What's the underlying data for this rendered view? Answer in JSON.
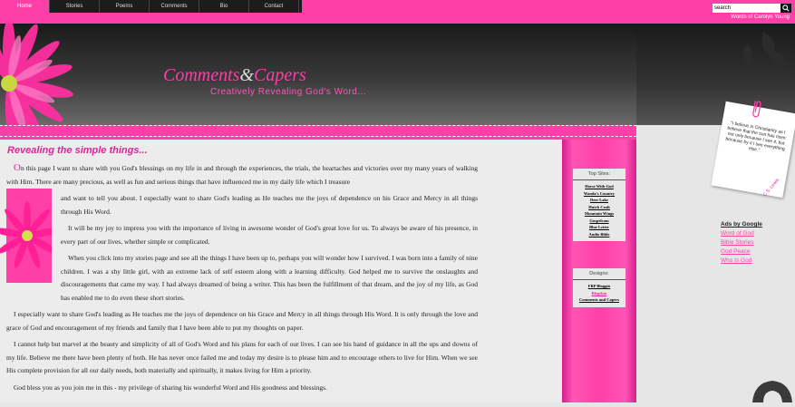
{
  "nav": {
    "items": [
      "Home",
      "Stories",
      "Poems",
      "Comments",
      "Bio",
      "Contact"
    ],
    "active": "Home"
  },
  "search": {
    "value": "search"
  },
  "header": {
    "tagline": "Words of Carolyn Young",
    "title_left": "Comments",
    "title_amp": "&",
    "title_right": "Capers",
    "subtitle": "Creatively Revealing God's Word..."
  },
  "content": {
    "heading": "Revealing the simple things...",
    "dropcap": "O",
    "p1a": "n this page I want to share with you God's blessings on my life in and through the experiences, the trials, the heartaches and victories over my many years of walking with Him. There are many precious, as well as fun and serious things that have influenced me in my daily life which I treasure",
    "p1b": "and want to tell you about. I especially want to share God's leading as He teaches me the joys of dependence on his Grace and Mercy in all things through His Word.",
    "p2": "It will be my joy to impress you with the importance of living in awesome wonder of God's great love for us. To always be aware of his presence, in every part of our lives, whether simple or complicated.",
    "p3": "When you click into my stories page and see all the things I have been up to, perhaps you will wonder how I survived. I was born into a family of nine children. I was a shy little girl, with an extreme lack of self esteem along with a learning difficulty. God helped me to survive the onslaughts and discouragements that came my way. I had always dreamed of being a writer. This has been the fulfillment of that dream, and the joy of my life, as God has enabled me to do even these short stories.",
    "p4": "I especially want to share God's leading as He teaches me the joys of dependence on his Grace and Mercy in all things through His Word. It is only through the love and grace of God and encouragement of my friends and family that I have been able to put my thoughts on paper.",
    "p5": "I cannot help but marvel at the beauty and simplicity of all of God's Word and his plans for each of our lives. I can see his hand of guidance in all the ups and downs of my life. Believe me there have been plenty of both. He has never once failed me and today my desire is to please him and to encourage others to live for Him. When we see His complete provision for all our daily needs, both materially and spiritually, it makes living for Him a priority.",
    "p6": "God bless you as you join me in this - my privilege of sharing his wonderful Word and His goodness and blessings."
  },
  "sidebar": {
    "top_sites_title": "Top Sites:",
    "top_sites": [
      "Horse With God",
      "Wanda's Country",
      "Deer Lake",
      "Hutch Craft",
      "Mountain Wings",
      "Gospelcom",
      "Blue Letter",
      "Audio Bible"
    ],
    "designs_title": "Designs:",
    "designs": [
      "FRP Bloggin",
      "Blogskin",
      "Comments and Capers"
    ]
  },
  "note": {
    "quote": "\"I believe in Christianity as I believe that the sun has risen: not only because I see it, but because by it I see everything else.\"",
    "author": "C.S. Lewis"
  },
  "ads": {
    "title": "Ads by Google",
    "links": [
      "Word of God",
      "Bible Stories",
      "God Peace",
      "Who Is God"
    ]
  },
  "colors": {
    "accent": "#ff3fa8",
    "heading": "#e0249a",
    "dark": "#1c1c1c"
  }
}
